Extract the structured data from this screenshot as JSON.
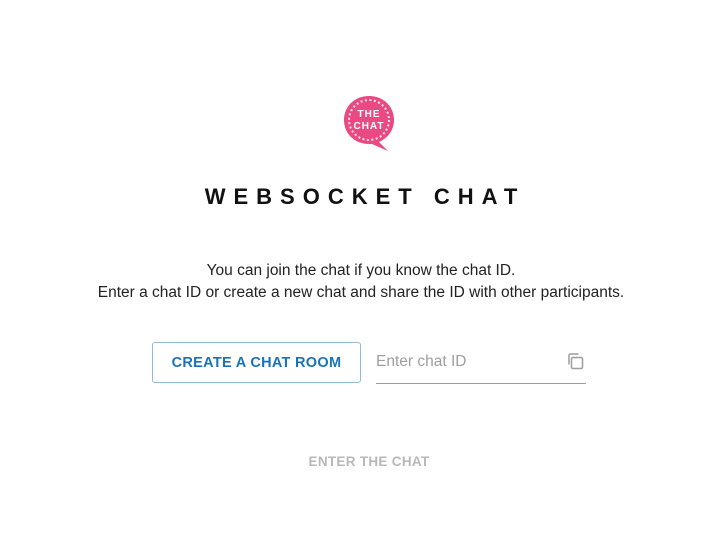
{
  "logo": {
    "line1": "THE",
    "line2": "CHAT",
    "color": "#e94a83"
  },
  "header": {
    "title": "WEBSOCKET CHAT"
  },
  "description": {
    "line1": "You can join the chat if you know the chat ID.",
    "line2": "Enter a chat ID or create a new chat and share the ID with other participants."
  },
  "actions": {
    "create_label": "CREATE A CHAT ROOM",
    "chat_id_value": "",
    "chat_id_placeholder": "Enter chat ID",
    "copy_icon": "copy-icon",
    "enter_label": "ENTER THE CHAT",
    "enter_disabled": true
  },
  "colors": {
    "accent": "#1a73b8",
    "accent_border": "#8fbcd9",
    "disabled_text": "#b8b8b8",
    "placeholder": "#9e9e9e"
  }
}
